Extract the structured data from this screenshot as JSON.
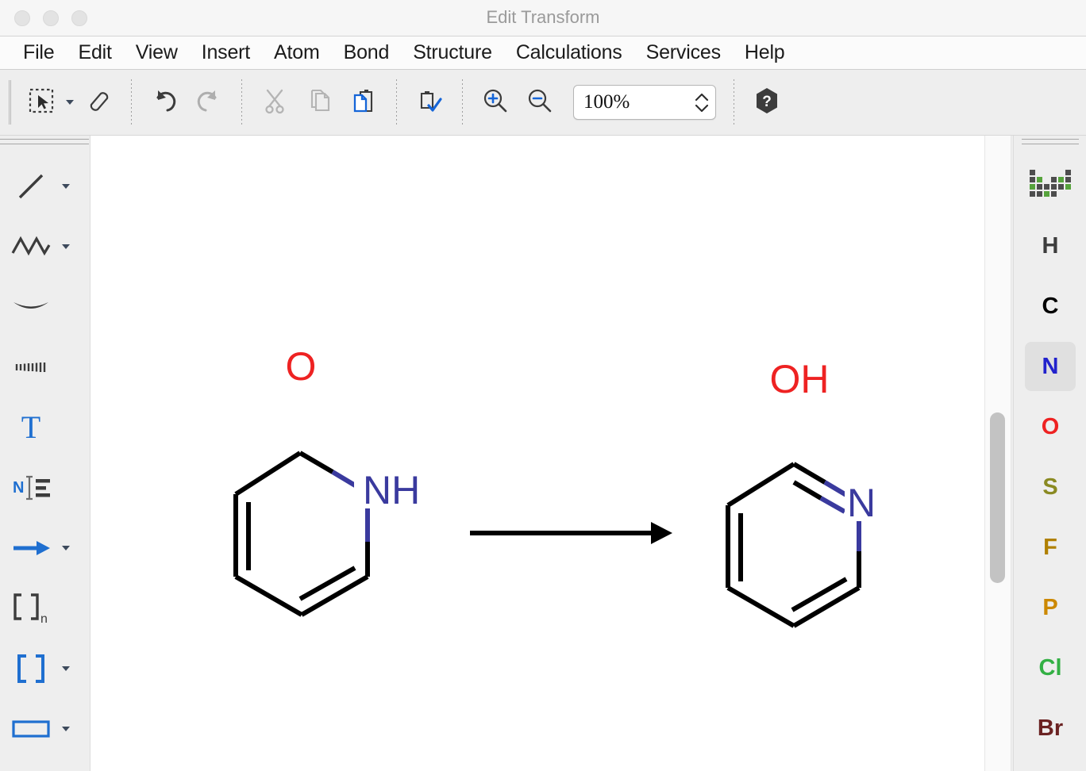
{
  "window": {
    "title": "Edit Transform",
    "traffic_lights": [
      "close",
      "minimize",
      "zoom"
    ]
  },
  "menubar": {
    "items": [
      {
        "label": "File"
      },
      {
        "label": "Edit"
      },
      {
        "label": "View"
      },
      {
        "label": "Insert"
      },
      {
        "label": "Atom"
      },
      {
        "label": "Bond"
      },
      {
        "label": "Structure"
      },
      {
        "label": "Calculations"
      },
      {
        "label": "Services"
      },
      {
        "label": "Help"
      }
    ]
  },
  "toolbar": {
    "buttons": [
      {
        "name": "selection-tool",
        "icon": "selection-marquee-icon",
        "has_dropdown": true,
        "enabled": true
      },
      {
        "name": "eraser-tool",
        "icon": "eraser-icon",
        "has_dropdown": false,
        "enabled": true
      },
      {
        "name": "undo",
        "icon": "undo-arrow-icon",
        "has_dropdown": false,
        "enabled": true
      },
      {
        "name": "redo",
        "icon": "redo-arrow-icon",
        "has_dropdown": false,
        "enabled": false
      },
      {
        "name": "cut",
        "icon": "scissors-icon",
        "has_dropdown": false,
        "enabled": false
      },
      {
        "name": "copy",
        "icon": "copy-pages-icon",
        "has_dropdown": false,
        "enabled": false
      },
      {
        "name": "paste",
        "icon": "clipboard-paste-icon",
        "has_dropdown": false,
        "enabled": true
      },
      {
        "name": "check-structure",
        "icon": "clipboard-check-icon",
        "has_dropdown": false,
        "enabled": true
      },
      {
        "name": "zoom-in",
        "icon": "magnifier-plus-icon",
        "has_dropdown": false,
        "enabled": true
      },
      {
        "name": "zoom-out",
        "icon": "magnifier-minus-icon",
        "has_dropdown": false,
        "enabled": true
      }
    ],
    "zoom_value": "100%",
    "help_button": {
      "name": "help",
      "icon": "help-hexagon-icon"
    }
  },
  "left_tools": [
    {
      "name": "single-bond-tool",
      "icon": "bond-line-icon",
      "has_dropdown": true
    },
    {
      "name": "chain-tool",
      "icon": "zigzag-chain-icon",
      "has_dropdown": true
    },
    {
      "name": "wedge-bond-tool",
      "icon": "bold-wedge-icon",
      "has_dropdown": false
    },
    {
      "name": "hash-bond-tool",
      "icon": "hashed-wedge-icon",
      "has_dropdown": false
    },
    {
      "name": "text-tool",
      "icon": "text-t-icon",
      "has_dropdown": false
    },
    {
      "name": "atom-label-tool",
      "icon": "atom-label-icon",
      "has_dropdown": false
    },
    {
      "name": "reaction-arrow-tool",
      "icon": "right-arrow-icon",
      "has_dropdown": true
    },
    {
      "name": "repeating-group-tool",
      "icon": "brackets-n-icon",
      "has_dropdown": false
    },
    {
      "name": "bracket-tool",
      "icon": "brackets-icon",
      "has_dropdown": true
    },
    {
      "name": "frame-tool",
      "icon": "rectangle-frame-icon",
      "has_dropdown": true
    }
  ],
  "right_elements": {
    "periodic_table_icon": "periodic-table-icon",
    "items": [
      {
        "symbol": "H",
        "color": "#3c3c3c",
        "selected": false
      },
      {
        "symbol": "C",
        "color": "#000000",
        "selected": false
      },
      {
        "symbol": "N",
        "color": "#2222cc",
        "selected": true
      },
      {
        "symbol": "O",
        "color": "#ee2222",
        "selected": false
      },
      {
        "symbol": "S",
        "color": "#8a8a22",
        "selected": false
      },
      {
        "symbol": "F",
        "color": "#b08000",
        "selected": false
      },
      {
        "symbol": "P",
        "color": "#cc8800",
        "selected": false
      },
      {
        "symbol": "Cl",
        "color": "#33b044",
        "selected": false
      },
      {
        "symbol": "Br",
        "color": "#6b2222",
        "selected": false
      }
    ]
  },
  "canvas": {
    "reaction": {
      "arrow": {
        "name": "reaction-arrow",
        "type": "single-right"
      },
      "reactant": {
        "name": "2-pyridone",
        "labels": [
          {
            "text": "O",
            "color": "#ee2222"
          },
          {
            "text": "NH",
            "color": "#3a3a9e"
          }
        ]
      },
      "product": {
        "name": "2-hydroxypyridine",
        "labels": [
          {
            "text": "OH",
            "color": "#ee2222"
          },
          {
            "text": "N",
            "color": "#3a3a9e"
          }
        ]
      }
    },
    "scrollbar": {
      "name": "vertical-scrollbar",
      "orientation": "vertical"
    }
  },
  "colors": {
    "oxygen": "#ee2222",
    "nitrogen": "#3a3a9e",
    "carbon": "#000000",
    "accent_blue": "#1f6fd0",
    "chrome": "#eeeeee"
  }
}
